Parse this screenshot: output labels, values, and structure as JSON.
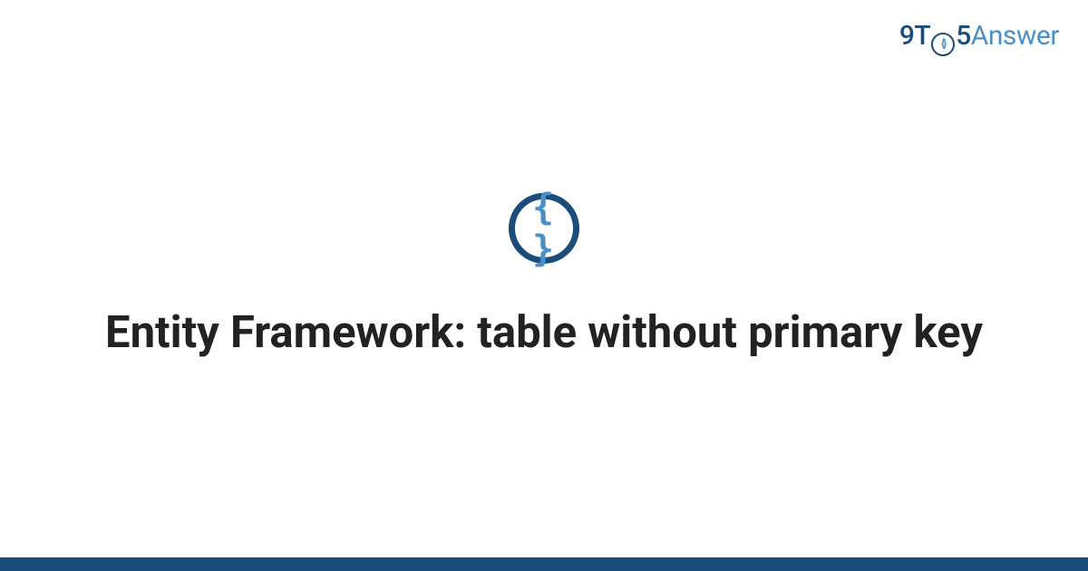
{
  "logo": {
    "part1": "9T",
    "o_inner": "{}",
    "part2": "5",
    "part3": "Answer"
  },
  "icon": {
    "braces": "{ }"
  },
  "title": "Entity Framework: table without primary key",
  "colors": {
    "dark_blue": "#1a4d7a",
    "light_blue": "#4a90c7",
    "text": "#222222"
  }
}
